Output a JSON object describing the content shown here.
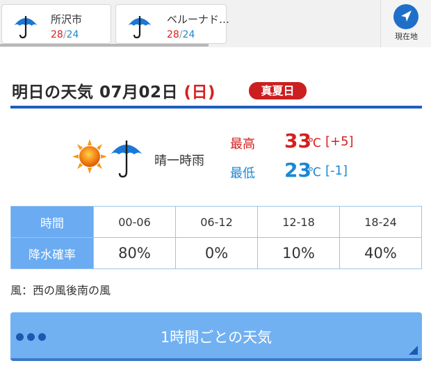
{
  "locations": [
    {
      "name": "所沢市",
      "high": "28",
      "sep": "/",
      "low": "24",
      "icon": "umbrella-icon"
    },
    {
      "name": "ベルーナド…",
      "high": "28",
      "sep": "/",
      "low": "24",
      "icon": "umbrella-icon"
    }
  ],
  "current_location": {
    "label": "現在地",
    "icon": "navigation-arrow-icon"
  },
  "day": {
    "title_prefix": "明日の天気 07月02日 ",
    "weekday": "(日)",
    "badge": "真夏日"
  },
  "summary": {
    "weather": "晴一時雨",
    "icon": "sun-with-umbrella-icon",
    "high": {
      "label": "最高",
      "value": "33",
      "unit": "℃",
      "diff": "[+5]"
    },
    "low": {
      "label": "最低",
      "value": "23",
      "unit": "℃",
      "diff": "[-1]"
    }
  },
  "precip_table": {
    "time_header": "時間",
    "precip_header": "降水確率",
    "periods": [
      "00-06",
      "06-12",
      "12-18",
      "18-24"
    ],
    "values": [
      "80%",
      "0%",
      "10%",
      "40%"
    ]
  },
  "wind": "風：西の風後南の風",
  "hourly_button": {
    "label": "1時間ごとの天気"
  },
  "colors": {
    "accent": "#1c5fbf",
    "high": "#d4201f",
    "low": "#1a87d4",
    "table_header": "#6aabf2",
    "button": "#71b1f2",
    "badge": "#cc1f1f"
  }
}
